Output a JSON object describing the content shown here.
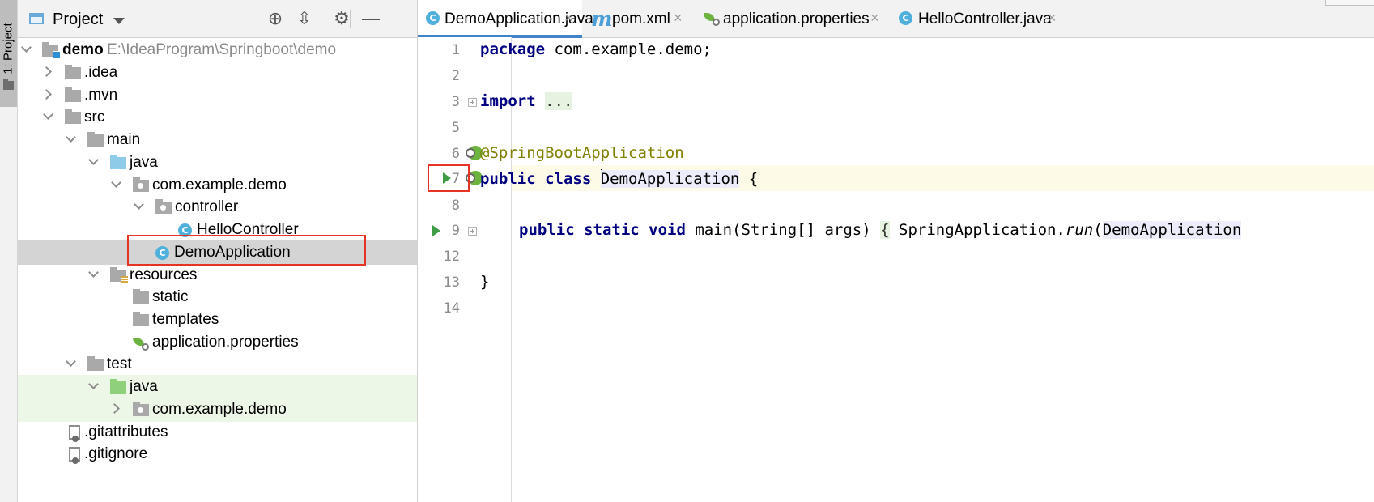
{
  "sidebar_strip": {
    "label": "1: Project"
  },
  "project": {
    "title": "Project",
    "tree": [
      {
        "label": "demo",
        "path": "E:\\IdeaProgram\\Springboot\\demo"
      },
      {
        "label": ".idea"
      },
      {
        "label": ".mvn"
      },
      {
        "label": "src"
      },
      {
        "label": "main"
      },
      {
        "label": "java"
      },
      {
        "label": "com.example.demo"
      },
      {
        "label": "controller"
      },
      {
        "label": "HelloController"
      },
      {
        "label": "DemoApplication"
      },
      {
        "label": "resources"
      },
      {
        "label": "static"
      },
      {
        "label": "templates"
      },
      {
        "label": "application.properties"
      },
      {
        "label": "test"
      },
      {
        "label": "java"
      },
      {
        "label": "com.example.demo"
      },
      {
        "label": ".gitattributes"
      },
      {
        "label": ".gitignore"
      }
    ]
  },
  "tabs": [
    {
      "label": "DemoApplication.java",
      "close": "×"
    },
    {
      "label": "pom.xml",
      "close": "×",
      "icon_letter": "m"
    },
    {
      "label": "application.properties",
      "close": "×"
    },
    {
      "label": "HelloController.java",
      "close": "×"
    }
  ],
  "icons": {
    "class_letter": "C"
  },
  "editor": {
    "line_numbers": [
      "1",
      "2",
      "3",
      "5",
      "6",
      "7",
      "8",
      "9",
      "12",
      "13",
      "14"
    ],
    "line1": {
      "kw": "package",
      "rest": " com.example.demo;"
    },
    "line3": {
      "kw": "import",
      "fold": "..."
    },
    "line6": {
      "annotation": "@SpringBootApplication"
    },
    "line7": {
      "kw": "public class",
      "cls_pre": "",
      "cls": "DemoApplication",
      "rest": " {"
    },
    "line9": {
      "kw": "public static void",
      "sig": " main(String[] args) ",
      "fold": "{",
      "call": " SpringApplication.",
      "method": "run",
      "paren": "(",
      "arg": "DemoApplication"
    },
    "line13": {
      "text": "}"
    }
  },
  "colors": {
    "accent": "#4083c9",
    "highlight_box": "#e53424",
    "keyword": "#000080",
    "annotation": "#808000",
    "run": "#3e9c45"
  }
}
